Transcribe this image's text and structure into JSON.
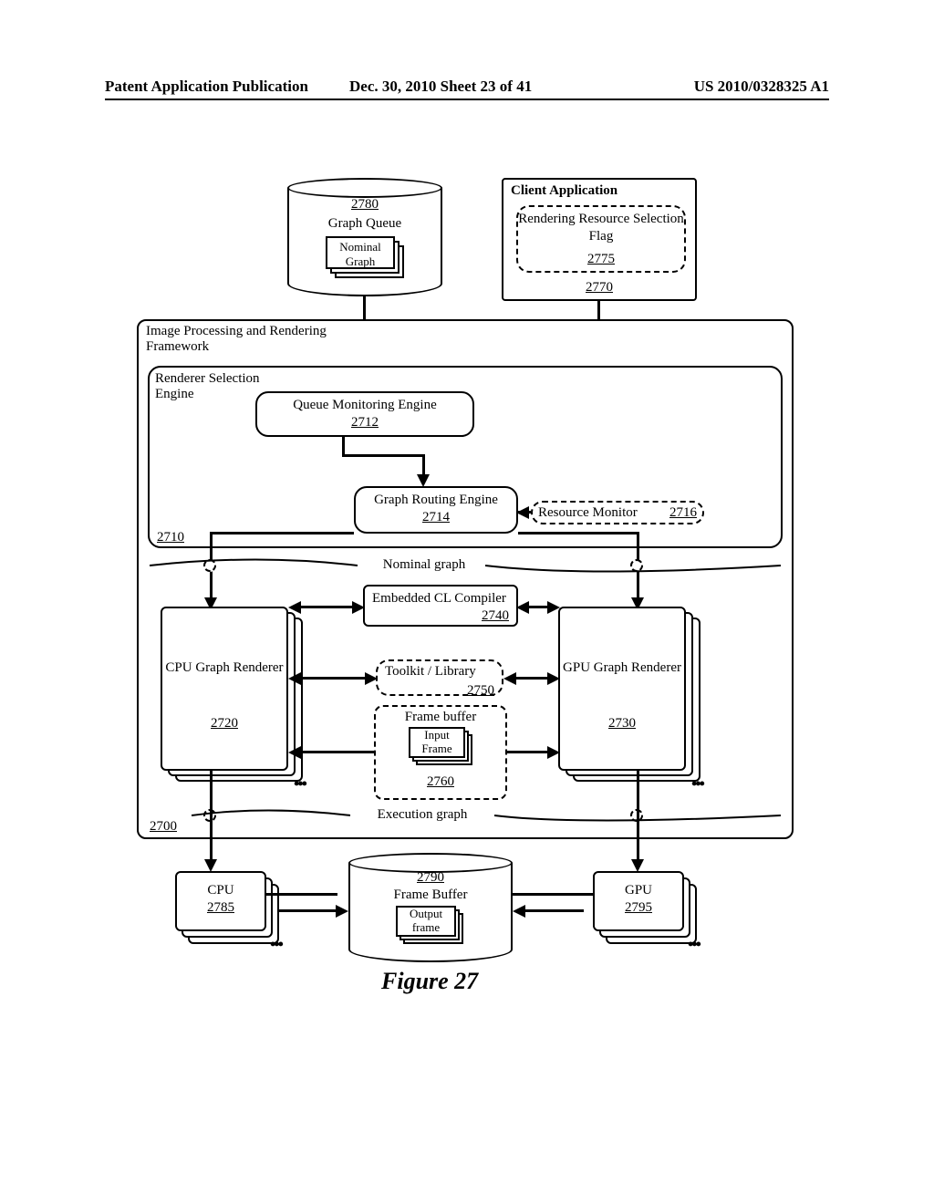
{
  "header": {
    "left": "Patent Application Publication",
    "center": "Dec. 30, 2010  Sheet 23 of 41",
    "right": "US 2010/0328325 A1"
  },
  "figure_caption": "Figure 27",
  "graph_queue": {
    "ref": "2780",
    "title": "Graph Queue",
    "item": "Nominal Graph"
  },
  "client_app": {
    "title": "Client Application",
    "flag_title": "Rendering Resource Selection Flag",
    "flag_ref": "2775",
    "ref": "2770"
  },
  "framework": {
    "title": "Image Processing and Rendering Framework",
    "ref": "2700"
  },
  "selector": {
    "title": "Renderer Selection Engine",
    "ref": "2710"
  },
  "qmon": {
    "title": "Queue Monitoring Engine",
    "ref": "2712"
  },
  "router": {
    "title": "Graph Routing Engine",
    "ref": "2714"
  },
  "resmon": {
    "title": "Resource Monitor",
    "ref": "2716"
  },
  "divider1": "Nominal graph",
  "divider2": "Execution graph",
  "cpu_renderer": {
    "title": "CPU Graph Renderer",
    "ref": "2720"
  },
  "gpu_renderer": {
    "title": "GPU Graph Renderer",
    "ref": "2730"
  },
  "compiler": {
    "title": "Embedded CL Compiler",
    "ref": "2740"
  },
  "toolkit": {
    "title": "Toolkit / Library",
    "ref": "2750"
  },
  "frame_buffer_in": {
    "title": "Frame buffer",
    "item": "Input Frame",
    "ref": "2760"
  },
  "frame_buffer_out": {
    "ref": "2790",
    "title": "Frame Buffer",
    "item": "Output frame"
  },
  "cpu": {
    "title": "CPU",
    "ref": "2785"
  },
  "gpu": {
    "title": "GPU",
    "ref": "2795"
  }
}
